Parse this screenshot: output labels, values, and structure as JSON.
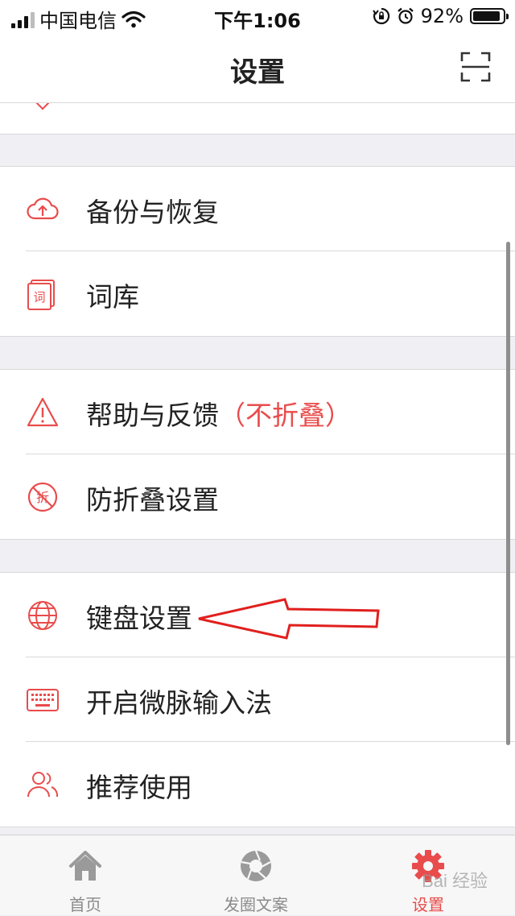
{
  "status_bar": {
    "carrier": "中国电信",
    "time": "下午1:06",
    "battery_text": "92%",
    "battery_level": 0.92
  },
  "nav": {
    "title": "设置",
    "scan_icon": "scan-icon"
  },
  "groups": [
    {
      "items": [
        {
          "label": "备份与恢复",
          "icon": "cloud-upload-icon"
        },
        {
          "label": "词库",
          "icon": "dictionary-icon"
        }
      ]
    },
    {
      "items": [
        {
          "label": "帮助与反馈",
          "extra": "（不折叠）",
          "icon": "warning-icon"
        },
        {
          "label": "防折叠设置",
          "icon": "anti-fold-icon"
        }
      ]
    },
    {
      "items": [
        {
          "label": "键盘设置",
          "icon": "globe-icon"
        },
        {
          "label": "开启微脉输入法",
          "icon": "keyboard-icon"
        },
        {
          "label": "推荐使用",
          "icon": "users-icon"
        }
      ]
    }
  ],
  "tabs": [
    {
      "label": "首页",
      "icon": "home-icon",
      "active": false
    },
    {
      "label": "发圈文案",
      "icon": "aperture-icon",
      "active": false
    },
    {
      "label": "设置",
      "icon": "gear-icon",
      "active": true
    }
  ],
  "watermark": "Bai 经验",
  "colors": {
    "accent": "#e94c4c",
    "annotation_arrow": "#e0201e",
    "tab_inactive": "#8a8a8a",
    "background": "#efeff4"
  }
}
